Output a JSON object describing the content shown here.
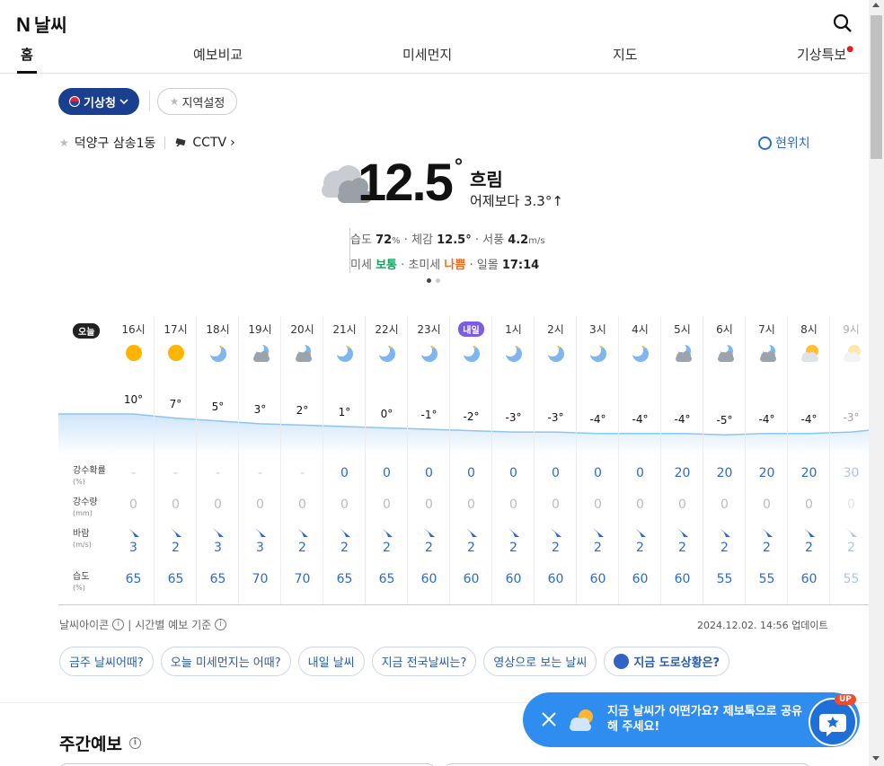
{
  "header": {
    "logo_n": "N",
    "title": "날씨"
  },
  "tabs": [
    {
      "label": "홈"
    },
    {
      "label": "예보비교"
    },
    {
      "label": "미세먼지"
    },
    {
      "label": "지도"
    },
    {
      "label": "기상특보"
    }
  ],
  "source": {
    "label": "기상청",
    "region_label": "지역설정"
  },
  "location": {
    "name": "덕양구 삼송1동",
    "cctv": "CCTV",
    "current_location": "현위치"
  },
  "current": {
    "icon": "cloudy-icon",
    "temp": "12.5",
    "deg": "°",
    "condition": "흐림",
    "compare": "어제보다 3.3°↑",
    "humidity_label": "습도",
    "humidity": "72",
    "humidity_unit": "%",
    "feels_label": "체감",
    "feels": "12.5°",
    "wind_label": "서풍",
    "wind": "4.2",
    "wind_unit": "m/s",
    "pm10_label": "미세",
    "pm10": "보통",
    "pm25_label": "초미세",
    "pm25": "나쁨",
    "sunset_label": "일몰",
    "sunset": "17:14",
    "colors": {
      "good": "#12a25e",
      "bad": "#f36b17",
      "accent": "#2a6bd1"
    }
  },
  "hourly": {
    "today_badge": "오늘",
    "tomorrow_badge": "내일",
    "labels": {
      "precip_prob": "강수확률",
      "precip_prob_unit": "(%)",
      "precip_amt": "강수량",
      "precip_amt_unit": "(mm)",
      "wind": "바람",
      "wind_unit": "(m/s)",
      "humidity": "습도",
      "humidity_unit": "(%)"
    },
    "items": [
      {
        "hour": "16시",
        "icon": "sun-icon",
        "temp": "10°",
        "t": 10,
        "prob": "-",
        "amt": "0",
        "wind": "3",
        "hum": "65"
      },
      {
        "hour": "17시",
        "icon": "sun-icon",
        "temp": "7°",
        "t": 7,
        "prob": "-",
        "amt": "0",
        "wind": "2",
        "hum": "65"
      },
      {
        "hour": "18시",
        "icon": "moon-icon",
        "temp": "5°",
        "t": 5,
        "prob": "-",
        "amt": "0",
        "wind": "3",
        "hum": "65"
      },
      {
        "hour": "19시",
        "icon": "moon-cloud-icon",
        "temp": "3°",
        "t": 3,
        "prob": "-",
        "amt": "0",
        "wind": "3",
        "hum": "70"
      },
      {
        "hour": "20시",
        "icon": "moon-cloud-icon",
        "temp": "2°",
        "t": 2,
        "prob": "-",
        "amt": "0",
        "wind": "2",
        "hum": "70"
      },
      {
        "hour": "21시",
        "icon": "moon-icon",
        "temp": "1°",
        "t": 1,
        "prob": "0",
        "amt": "0",
        "wind": "2",
        "hum": "65"
      },
      {
        "hour": "22시",
        "icon": "moon-icon",
        "temp": "0°",
        "t": 0,
        "prob": "0",
        "amt": "0",
        "wind": "2",
        "hum": "65"
      },
      {
        "hour": "23시",
        "icon": "moon-icon",
        "temp": "-1°",
        "t": -1,
        "prob": "0",
        "amt": "0",
        "wind": "2",
        "hum": "60"
      },
      {
        "hour": "",
        "icon": "moon-icon",
        "temp": "-2°",
        "t": -2,
        "prob": "0",
        "amt": "0",
        "wind": "2",
        "hum": "60"
      },
      {
        "hour": "1시",
        "icon": "moon-icon",
        "temp": "-3°",
        "t": -3,
        "prob": "0",
        "amt": "0",
        "wind": "2",
        "hum": "60"
      },
      {
        "hour": "2시",
        "icon": "moon-icon",
        "temp": "-3°",
        "t": -3,
        "prob": "0",
        "amt": "0",
        "wind": "2",
        "hum": "60"
      },
      {
        "hour": "3시",
        "icon": "moon-icon",
        "temp": "-4°",
        "t": -4,
        "prob": "0",
        "amt": "0",
        "wind": "2",
        "hum": "60"
      },
      {
        "hour": "4시",
        "icon": "moon-icon",
        "temp": "-4°",
        "t": -4,
        "prob": "0",
        "amt": "0",
        "wind": "2",
        "hum": "60"
      },
      {
        "hour": "5시",
        "icon": "moon-cloud-icon",
        "temp": "-4°",
        "t": -4,
        "prob": "20",
        "amt": "0",
        "wind": "2",
        "hum": "60"
      },
      {
        "hour": "6시",
        "icon": "moon-cloud-icon",
        "temp": "-5°",
        "t": -5,
        "prob": "20",
        "amt": "0",
        "wind": "2",
        "hum": "55"
      },
      {
        "hour": "7시",
        "icon": "moon-cloud-icon",
        "temp": "-4°",
        "t": -4,
        "prob": "20",
        "amt": "0",
        "wind": "2",
        "hum": "55"
      },
      {
        "hour": "8시",
        "icon": "sun-cloud-icon",
        "temp": "-4°",
        "t": -4,
        "prob": "20",
        "amt": "0",
        "wind": "2",
        "hum": "60"
      },
      {
        "hour": "9시",
        "icon": "sun-cloud-icon",
        "temp": "-3°",
        "t": -3,
        "prob": "30",
        "amt": "0",
        "wind": "2",
        "hum": "55"
      }
    ]
  },
  "footnote": {
    "icon_info": "날씨아이콘",
    "basis": "시간별 예보 기준",
    "updated": "2024.12.02. 14:56 업데이트"
  },
  "chips": [
    "금주 날씨어때?",
    "오늘 미세먼지는 어때?",
    "내일 날씨",
    "지금 전국날씨는?",
    "영상으로 보는 날씨",
    "지금 도로상황은?"
  ],
  "weekly": {
    "title": "주간예보"
  },
  "toast": {
    "message": "지금 날씨가 어떤가요? 제보톡으로 공유해 주세요!",
    "badge": "UP"
  }
}
